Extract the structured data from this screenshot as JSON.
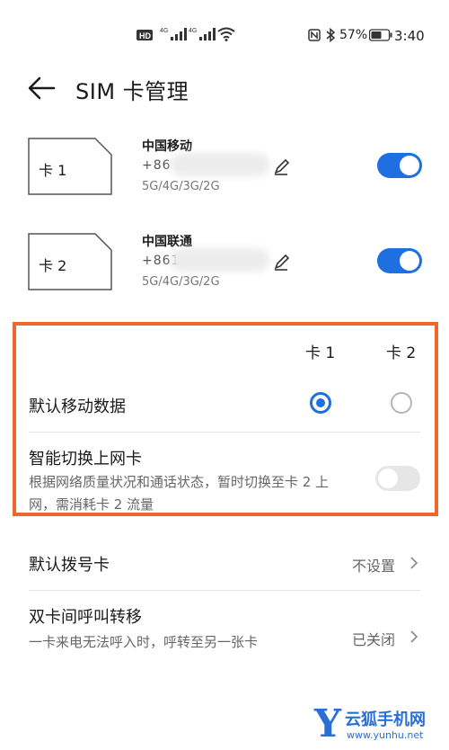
{
  "status_bar": {
    "time": "3:40",
    "battery": "57%",
    "icons": [
      "hd-icon",
      "signal-4g-icon",
      "signal-4g-icon",
      "wifi-icon",
      "nfc-icon",
      "bluetooth-icon",
      "battery-icon"
    ]
  },
  "header": {
    "title": "SIM 卡管理"
  },
  "sims": [
    {
      "card_label": "卡 1",
      "carrier": "中国移动",
      "number": "+86",
      "network": "5G/4G/3G/2G",
      "enabled": true
    },
    {
      "card_label": "卡 2",
      "carrier": "中国联通",
      "number": "+861",
      "network": "5G/4G/3G/2G",
      "enabled": true
    }
  ],
  "columns": {
    "card1": "卡 1",
    "card2": "卡 2"
  },
  "default_data": {
    "label": "默认移动数据",
    "selected": "card1"
  },
  "smart_switch": {
    "label": "智能切换上网卡",
    "description": "根据网络质量状况和通话状态，暂时切换至卡 2 上网，需消耗卡 2 流量",
    "enabled": false
  },
  "default_dial": {
    "label": "默认拨号卡",
    "value": "不设置"
  },
  "call_forward": {
    "label": "双卡间呼叫转移",
    "description": "一卡来电无法呼入时，呼转至另一张卡",
    "value": "已关闭"
  },
  "watermark": {
    "brand": "云狐手机网",
    "url": "www.yunhu.net",
    "logo_letter": "Y"
  },
  "colors": {
    "accent": "#1e6fe0",
    "highlight_border": "#f0672e"
  }
}
